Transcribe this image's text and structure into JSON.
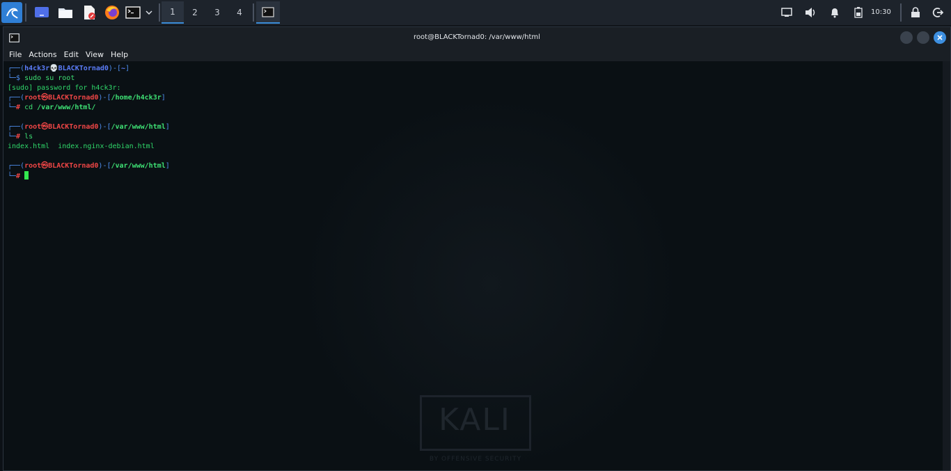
{
  "panel": {
    "apps": [
      {
        "name": "kali-menu-icon"
      },
      {
        "name": "desktop-icon"
      },
      {
        "name": "file-manager-icon"
      },
      {
        "name": "text-editor-icon"
      },
      {
        "name": "firefox-icon"
      },
      {
        "name": "terminal-launcher-icon"
      },
      {
        "name": "chevron-down-icon"
      }
    ],
    "workspaces": [
      "1",
      "2",
      "3",
      "4"
    ],
    "active_workspace": "1",
    "clock": "10:30"
  },
  "window": {
    "title": "root@BLACKTornad0: /var/www/html",
    "menu": [
      "File",
      "Actions",
      "Edit",
      "View",
      "Help"
    ]
  },
  "terminal": {
    "l1_a": "┌──(",
    "l1_user": "h4ck3r",
    "l1_skull": "💀",
    "l1_host": "BLACKTornad0",
    "l1_b": ")-[",
    "l1_dir": "~",
    "l1_c": "]",
    "l2_prompt": "└─$ ",
    "l2_cmd": "sudo su root",
    "l3": "[sudo] password for h4ck3r:",
    "l4_a": "┌──(",
    "l4_user": "root㉿BLACKTornad0",
    "l4_b": ")-[",
    "l4_dir": "/home/h4ck3r",
    "l4_c": "]",
    "l5_prompt": "└─",
    "l5_hash": "# ",
    "l5_cmd": "cd ",
    "l5_arg": "/var/www/html/",
    "l7_a": "┌──(",
    "l7_user": "root㉿BLACKTornad0",
    "l7_b": ")-[",
    "l7_dir": "/var/www/html",
    "l7_c": "]",
    "l8_prompt": "└─",
    "l8_hash": "# ",
    "l8_cmd": "ls",
    "l9": "index.html  index.nginx-debian.html",
    "l11_a": "┌──(",
    "l11_user": "root㉿BLACKTornad0",
    "l11_b": ")-[",
    "l11_dir": "/var/www/html",
    "l11_c": "]",
    "l12_prompt": "└─",
    "l12_hash": "# "
  },
  "watermark": {
    "title": "KALI",
    "subtitle": "BY OFFENSIVE SECURITY"
  },
  "colors": {
    "accent": "#3b8dd9",
    "prompt_green": "#2fd86a",
    "root_red": "#f04646",
    "user_blue": "#5b7cf8"
  }
}
